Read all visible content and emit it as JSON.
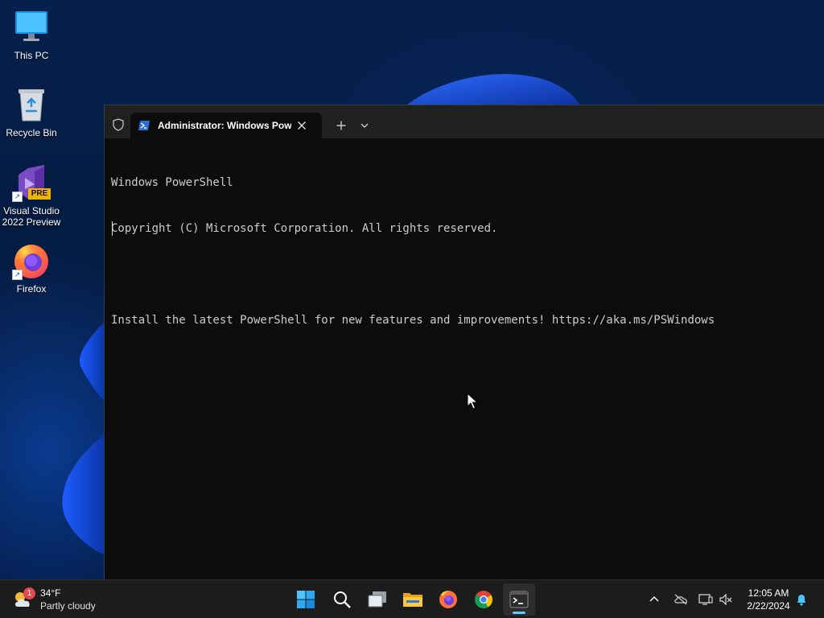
{
  "desktop": {
    "icons": [
      {
        "label": "This PC",
        "icon": "this-pc-icon"
      },
      {
        "label": "Recycle Bin",
        "icon": "recycle-bin-icon"
      },
      {
        "label_line1": "Visual Studio",
        "label_line2": "2022 Preview",
        "badge": "PRE",
        "icon": "visual-studio-icon"
      },
      {
        "label": "Firefox",
        "icon": "firefox-icon"
      }
    ]
  },
  "terminal": {
    "tab_title": "Administrator: Windows PowerShell",
    "lines": [
      "Windows PowerShell",
      "Copyright (C) Microsoft Corporation. All rights reserved.",
      "",
      "Install the latest PowerShell for new features and improvements! https://aka.ms/PSWindows"
    ]
  },
  "taskbar": {
    "weather": {
      "temp": "34°F",
      "desc": "Partly cloudy",
      "badge": "1"
    },
    "apps": [
      "start-icon",
      "search-icon",
      "task-view-icon",
      "file-explorer-icon",
      "firefox-icon",
      "chrome-icon",
      "terminal-icon"
    ],
    "active_app": "terminal-icon",
    "clock": {
      "time": "12:05 AM",
      "date": "2/22/2024"
    }
  },
  "colors": {
    "accent": "#60cdff",
    "terminal_bg": "#0c0c0c",
    "titlebar_bg": "#202020",
    "taskbar_bg": "#1c1c1c",
    "text": "#cccccc"
  }
}
